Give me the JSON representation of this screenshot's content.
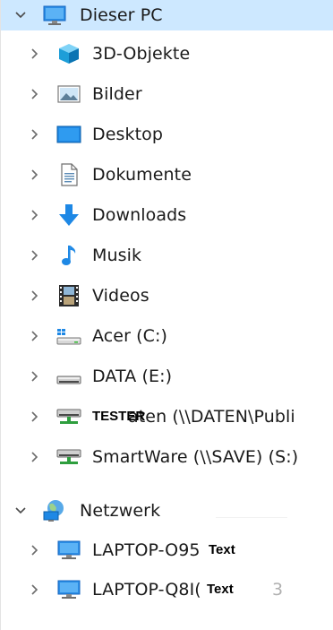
{
  "tree": {
    "this_pc": {
      "label": "Dieser PC",
      "icon": "monitor-icon",
      "expanded": true,
      "selected": true
    },
    "pc_children": [
      {
        "label": "3D-Objekte",
        "icon": "3d-objects-icon"
      },
      {
        "label": "Bilder",
        "icon": "pictures-icon"
      },
      {
        "label": "Desktop",
        "icon": "desktop-icon"
      },
      {
        "label": "Dokumente",
        "icon": "documents-icon"
      },
      {
        "label": "Downloads",
        "icon": "downloads-icon"
      },
      {
        "label": "Musik",
        "icon": "music-icon"
      },
      {
        "label": "Videos",
        "icon": "videos-icon"
      },
      {
        "label": "Acer (C:)",
        "icon": "windows-drive-icon"
      },
      {
        "label": "DATA (E:)",
        "icon": "drive-icon"
      },
      {
        "label": "aten (\\\\DATEN\\Publi",
        "icon": "network-drive-icon",
        "redaction": "TESTER"
      },
      {
        "label": "SmartWare (\\\\SAVE) (S:)",
        "icon": "network-drive-icon"
      }
    ],
    "network": {
      "label": "Netzwerk",
      "icon": "network-icon",
      "expanded": true
    },
    "network_children": [
      {
        "label": "LAPTOP-O95",
        "icon": "computer-icon",
        "redaction": "Text"
      },
      {
        "label": "LAPTOP-Q8I(",
        "icon": "computer-icon",
        "redaction": "Text",
        "tail": "3"
      }
    ]
  },
  "colors": {
    "selected_bg": "#cde8ff",
    "text": "#1a1a1a",
    "chevron": "#6b6b6b",
    "folder_blue": "#1e88e5"
  }
}
